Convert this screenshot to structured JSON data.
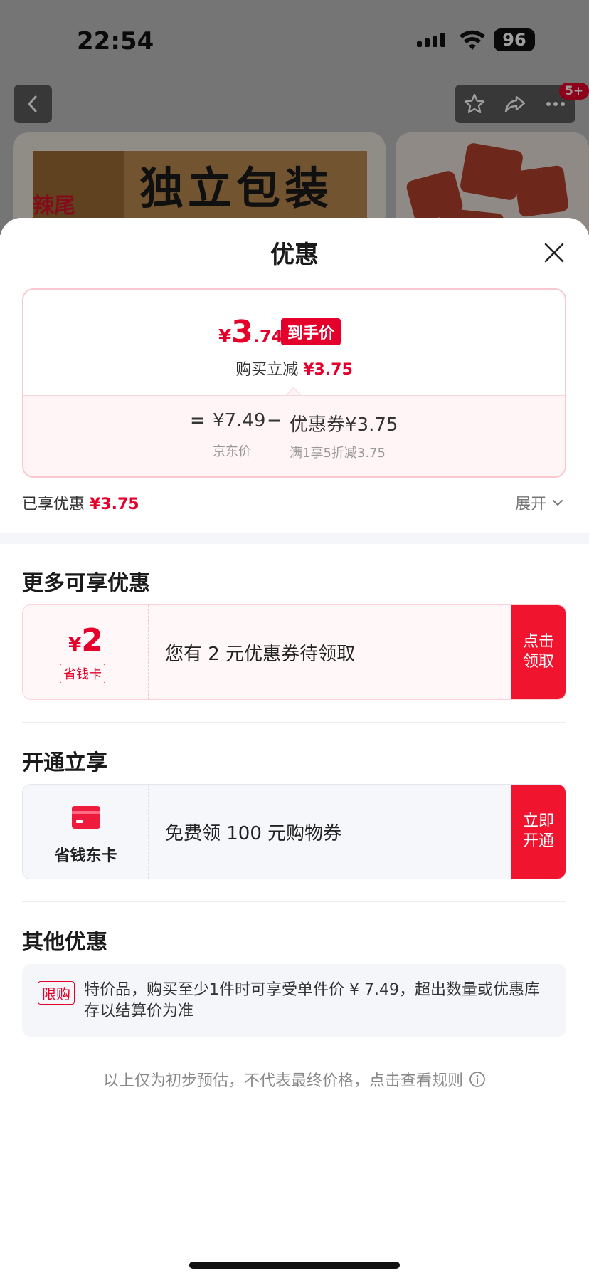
{
  "status_bar": {
    "time": "22:54",
    "battery": "96"
  },
  "background": {
    "badge": "5+",
    "product_text": "独立包装",
    "product_red_text": "辣尾"
  },
  "sheet": {
    "title": "优惠",
    "price": {
      "currency": "¥",
      "integer": "3",
      "decimal": ".74",
      "tag": "到手价",
      "cut_label": "购买立减",
      "cut_value": "¥3.75",
      "equals": "=",
      "jd_price": "¥7.49",
      "minus": "−",
      "coupon_label": "优惠券¥3.75",
      "jd_price_label": "京东价",
      "coupon_desc": "满1享5折减3.75"
    },
    "enjoyed": {
      "label": "已享优惠",
      "value": "¥3.75",
      "expand": "展开"
    },
    "more": {
      "title": "更多可享优惠",
      "coupon_currency": "¥",
      "coupon_amount": "2",
      "coupon_card_name": "省钱卡",
      "coupon_text": "您有 2 元优惠券待领取",
      "button_line1": "点击",
      "button_line2": "领取"
    },
    "open": {
      "title": "开通立享",
      "card_name": "省钱东卡",
      "text": "免费领 100 元购物券",
      "button_line1": "立即",
      "button_line2": "开通"
    },
    "other": {
      "title": "其他优惠",
      "tag": "限购",
      "text": "特价品，购买至少1件时可享受单件价 ¥ 7.49，超出数量或优惠库存以结算价为准"
    },
    "footer": "以上仅为初步预估，不代表最终价格，点击查看规则"
  },
  "colors": {
    "accent": "#e4002b",
    "button": "#f0142f"
  }
}
